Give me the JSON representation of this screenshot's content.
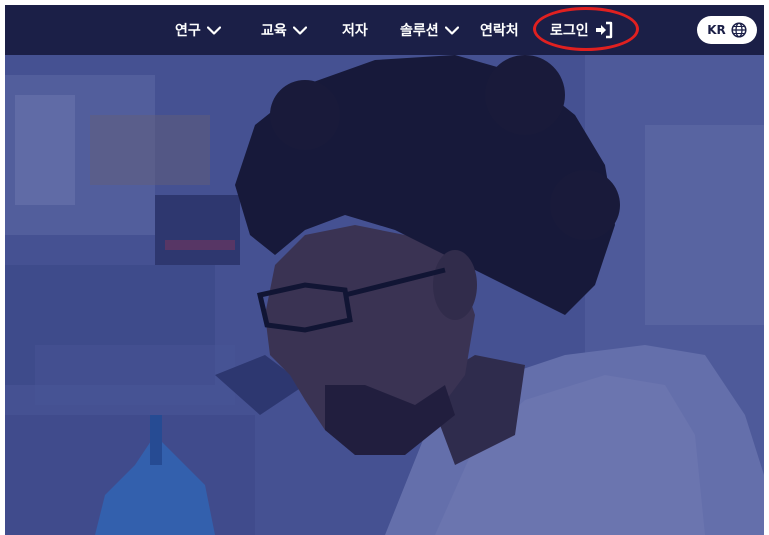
{
  "nav": {
    "items": [
      {
        "label": "연구",
        "has_dropdown": true
      },
      {
        "label": "교육",
        "has_dropdown": true
      },
      {
        "label": "저자",
        "has_dropdown": false
      },
      {
        "label": "솔루션",
        "has_dropdown": true
      },
      {
        "label": "연락처",
        "has_dropdown": false
      }
    ],
    "login_label": "로그인",
    "login_icon": "sign-in-icon",
    "language_code": "KR",
    "language_icon": "globe-icon"
  },
  "hero": {
    "image": "scientist-in-lab-photo"
  },
  "annotation": {
    "highlight_color": "#e02020",
    "highlight_target": "login-link"
  },
  "colors": {
    "nav_background": "#1b1f47",
    "hero_tint": "#4a5896"
  }
}
